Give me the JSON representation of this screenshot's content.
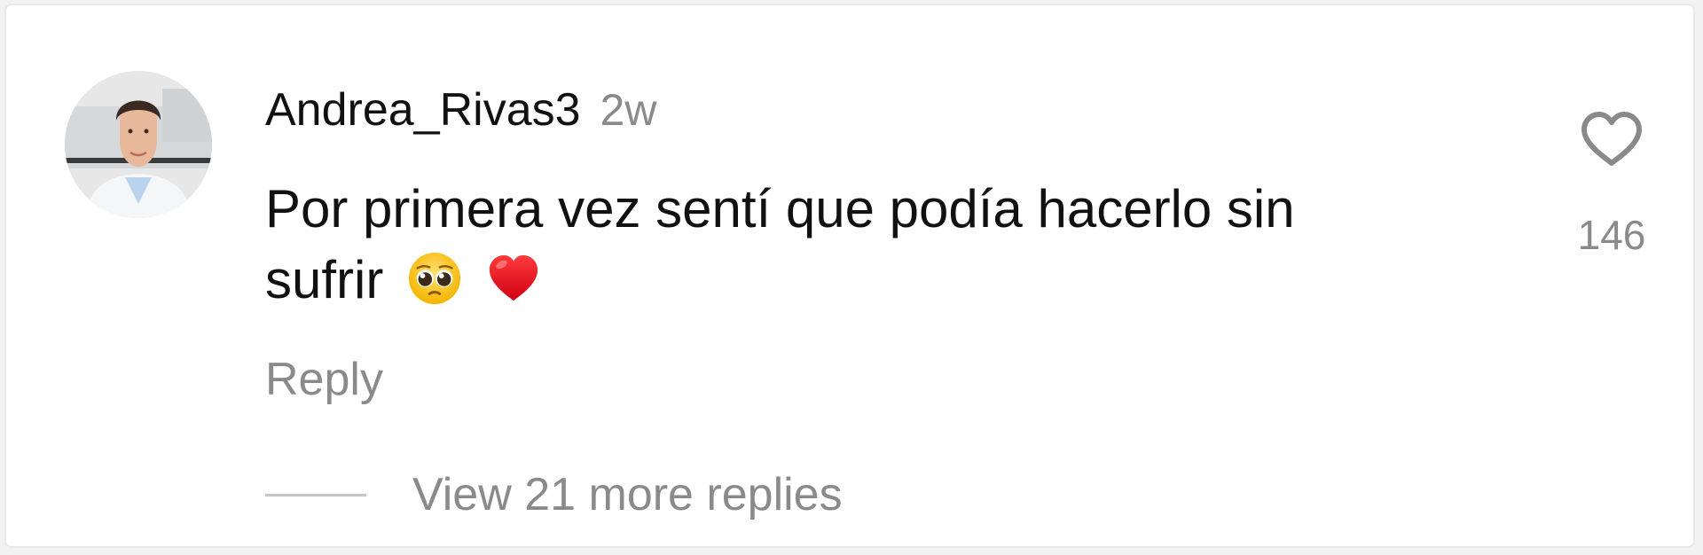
{
  "comment": {
    "username": "Andrea_Rivas3",
    "time_ago": "2w",
    "text": "Por primera vez sentí que podía hacerlo sin sufrir",
    "emojis": [
      "pleading-face",
      "red-heart"
    ],
    "reply_label": "Reply",
    "view_more_label": "View 21 more replies",
    "like_count": "146",
    "avatar": "profile-photo-woman-lab-coat"
  },
  "colors": {
    "primary_text": "#111111",
    "secondary_text": "#8a8a8a",
    "divider": "#c4c4c4",
    "heart_outline": "#8a8a8a"
  }
}
